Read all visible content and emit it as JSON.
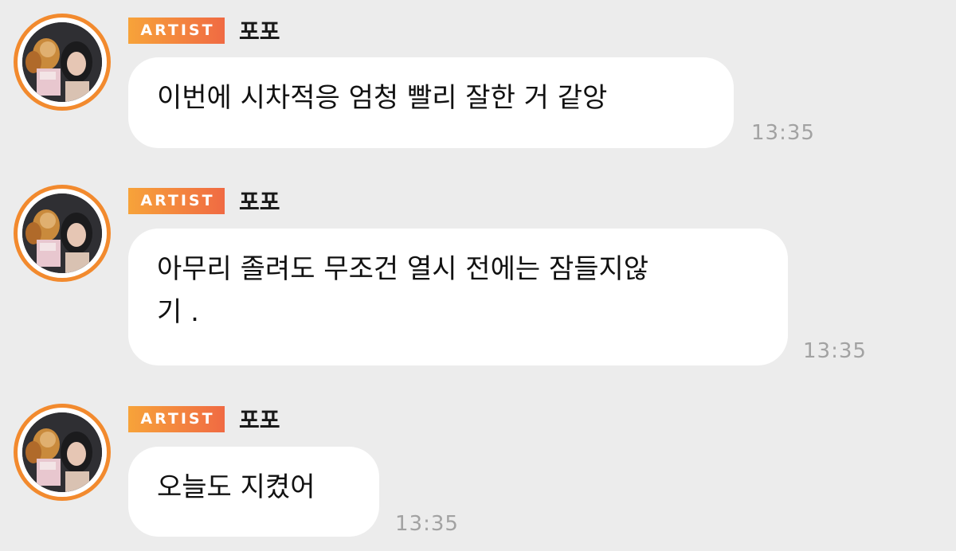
{
  "colors": {
    "background": "#ececec",
    "badge_start": "#f7a33a",
    "badge_end": "#f06a43",
    "avatar_ring": "#f28a2e",
    "bubble": "#ffffff",
    "timestamp": "#a2a2a2"
  },
  "messages": [
    {
      "badge": "ARTIST",
      "sender": "포포",
      "lines": [
        "이번에 시차적응 엄청 빨리 잘한 거 같앙"
      ],
      "time": "13:35"
    },
    {
      "badge": "ARTIST",
      "sender": "포포",
      "lines": [
        "아무리 졸려도 무조건 열시 전에는 잠들지않",
        "기 ."
      ],
      "time": "13:35"
    },
    {
      "badge": "ARTIST",
      "sender": "포포",
      "lines": [
        "오늘도 지켰어"
      ],
      "time": "13:35"
    }
  ]
}
